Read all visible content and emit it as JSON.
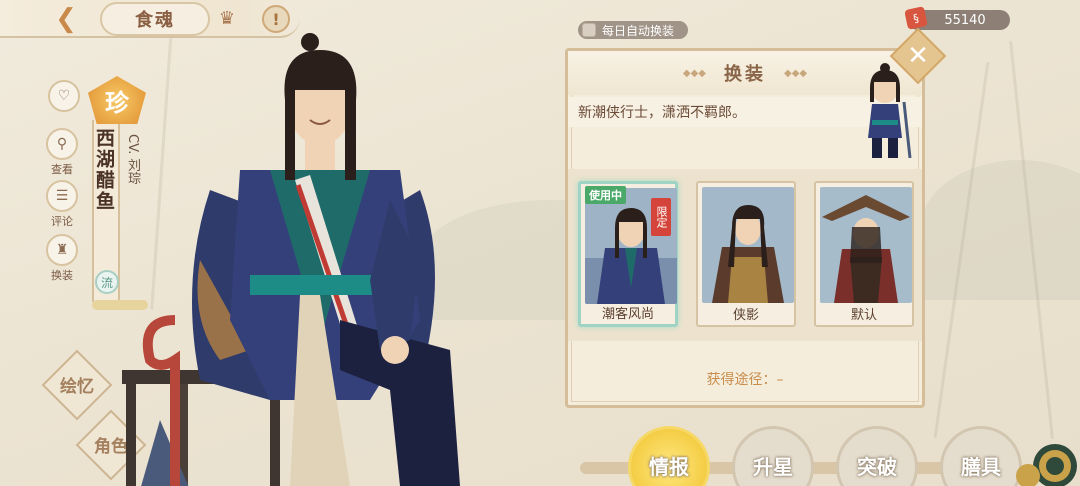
{
  "topbar": {
    "title": "食魂",
    "back_icon": "chevron-left-icon",
    "crown_icon": "crown-icon",
    "alert_icon": "exclamation-icon"
  },
  "currency": {
    "amount": "55140",
    "icon": "coupon-icon"
  },
  "side_buttons": [
    {
      "label": "",
      "icon": "heart-icon"
    },
    {
      "label": "查看",
      "icon": "magnifier-icon"
    },
    {
      "label": "评论",
      "icon": "speech-bubble-icon"
    },
    {
      "label": "换装",
      "icon": "costume-icon"
    }
  ],
  "character": {
    "rarity": "珍",
    "name": "西湖醋鱼",
    "cv": "CV. 刘琮",
    "element": "流"
  },
  "diamonds": {
    "sketch": "绘忆",
    "role": "角色"
  },
  "auto_equip": {
    "label": "每日自动换装",
    "checked": false
  },
  "panel": {
    "title": "换装",
    "description": "新潮侠行士，潇洒不羁郎。",
    "skins": [
      {
        "name": "潮客风尚",
        "in_use": "使用中",
        "limited": "限定",
        "active": true
      },
      {
        "name": "侠影",
        "in_use": "",
        "limited": "",
        "active": false
      },
      {
        "name": "默认",
        "in_use": "",
        "limited": "",
        "active": false
      }
    ],
    "obtain": "获得途径：–"
  },
  "tabs": [
    {
      "label": "情报",
      "active": true
    },
    {
      "label": "升星",
      "active": false
    },
    {
      "label": "突破",
      "active": false
    },
    {
      "label": "膳具",
      "active": false
    }
  ],
  "colors": {
    "accent": "#f2c93c",
    "in_use": "#4aa869",
    "limited": "#d5443a",
    "rarity": "#e49b3b"
  }
}
